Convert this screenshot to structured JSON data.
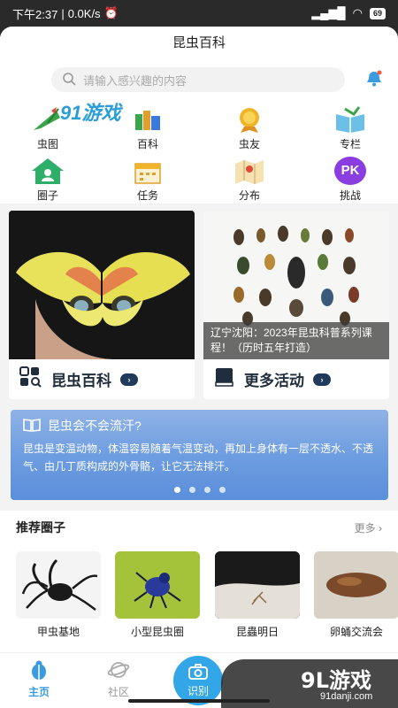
{
  "status": {
    "time": "下午2:37",
    "speed": "0.0K/s",
    "battery": "69"
  },
  "app": {
    "title": "昆虫百科"
  },
  "search": {
    "placeholder": "请输入感兴趣的内容"
  },
  "grid": [
    {
      "label": "虫图",
      "icon": "leaf-icon"
    },
    {
      "label": "百科",
      "icon": "books-icon"
    },
    {
      "label": "虫友",
      "icon": "medal-icon"
    },
    {
      "label": "专栏",
      "icon": "book-open-icon"
    },
    {
      "label": "圈子",
      "icon": "house-icon"
    },
    {
      "label": "任务",
      "icon": "calendar-icon"
    },
    {
      "label": "分布",
      "icon": "map-icon"
    },
    {
      "label": "挑战",
      "icon": "pk-icon",
      "badge": "PK"
    }
  ],
  "cards": {
    "left": {
      "label": "昆虫百科"
    },
    "right": {
      "label": "更多活动",
      "caption": "辽宁沈阳：2023年昆虫科普系列课程！（历时五年打造）"
    }
  },
  "banner": {
    "title": "昆虫会不会流汗?",
    "body": "昆虫是变温动物，体温容易随着气温变动，再加上身体有一层不透水、不透气、由几丁质构成的外骨骼，让它无法排汗。",
    "slides": 4,
    "active": 0
  },
  "recommend": {
    "title": "推荐圈子",
    "more": "更多 ›",
    "items": [
      "甲虫基地",
      "小型昆虫圈",
      "昆蟲明日",
      "卵蛹交流会"
    ]
  },
  "tabs": {
    "home": "主页",
    "community": "社区",
    "scan": "识别"
  },
  "watermark": {
    "brand": "9L游戏",
    "site": "91danji.com",
    "overlay": "91游戏"
  },
  "colors": {
    "accent": "#3a9be0",
    "banner": "#6f9de0",
    "cardText": "#1f2d3d"
  }
}
